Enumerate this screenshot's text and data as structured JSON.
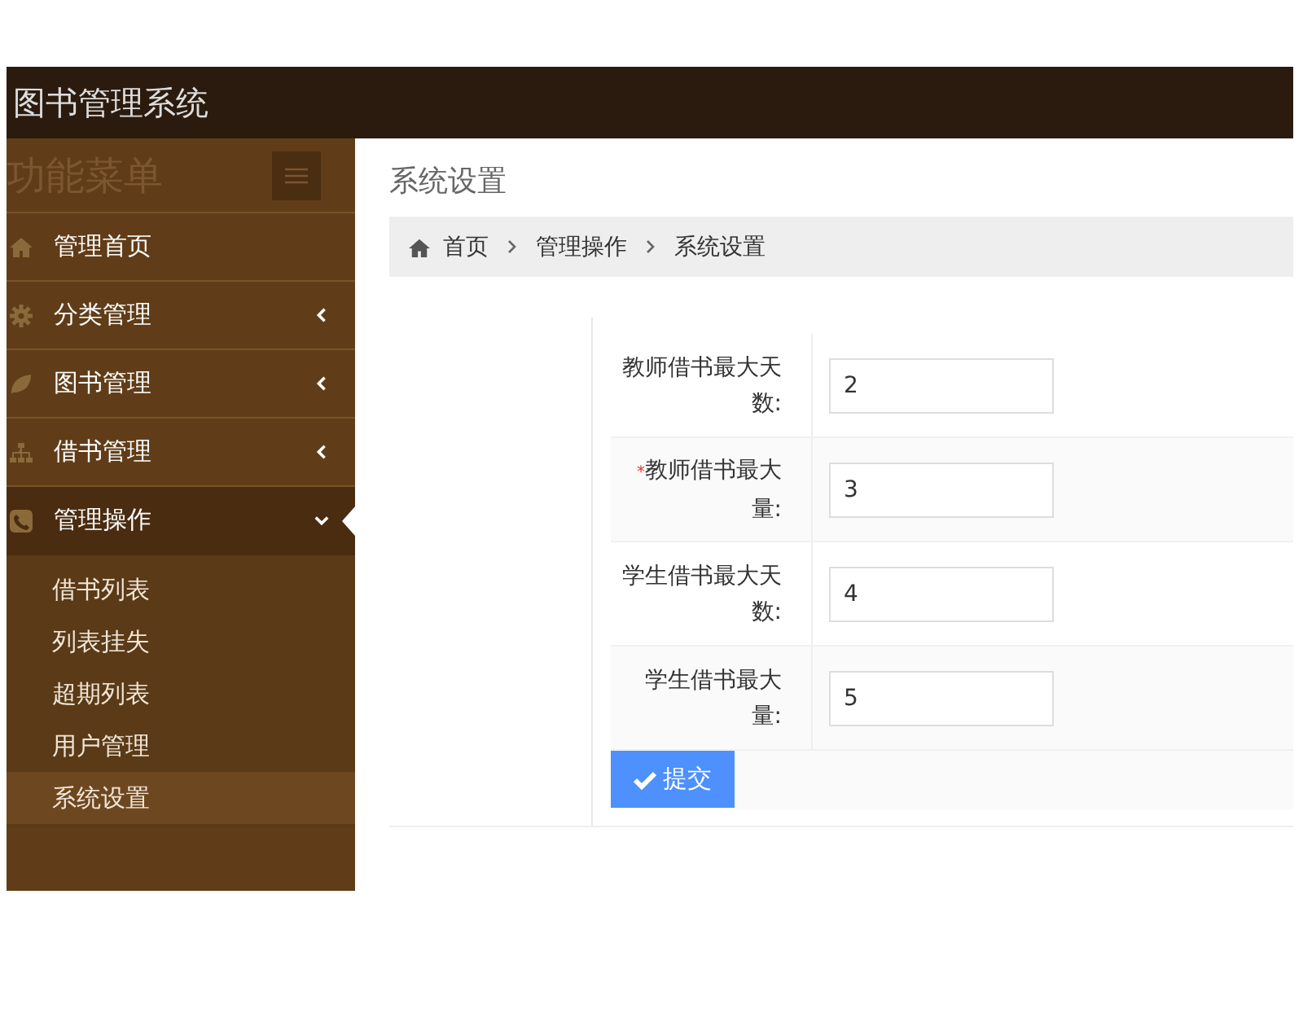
{
  "header": {
    "title": "图书管理系统"
  },
  "sidebar": {
    "heading": "功能菜单",
    "items": [
      {
        "label": "管理首页",
        "kind": "home",
        "selected": false
      },
      {
        "label": "分类管理",
        "kind": "gear",
        "expanded": false,
        "selected": false
      },
      {
        "label": "图书管理",
        "kind": "leaf",
        "expanded": false,
        "selected": false
      },
      {
        "label": "借书管理",
        "kind": "sitemap",
        "expanded": false,
        "selected": false
      },
      {
        "label": "管理操作",
        "kind": "phone",
        "expanded": true,
        "selected": true,
        "children": [
          {
            "label": "借书列表",
            "selected": false
          },
          {
            "label": "列表挂失",
            "selected": false
          },
          {
            "label": "超期列表",
            "selected": false
          },
          {
            "label": "用户管理",
            "selected": false
          },
          {
            "label": "系统设置",
            "selected": true
          }
        ]
      }
    ]
  },
  "page": {
    "title": "系统设置",
    "breadcrumb": [
      "首页",
      "管理操作",
      "系统设置"
    ]
  },
  "form": {
    "fields": [
      {
        "label": "教师借书最大天数:",
        "value": "2"
      },
      {
        "label": "教师借书最大量:",
        "marker": "*",
        "value": "3"
      },
      {
        "label": "学生借书最大天数:",
        "value": "4"
      },
      {
        "label": "学生借书最大量:",
        "value": "5"
      }
    ],
    "submit": "提交"
  }
}
